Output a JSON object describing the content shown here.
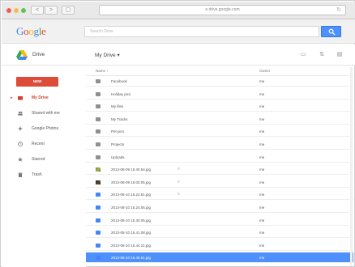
{
  "browser": {
    "url": "a drive.google.com",
    "back": "<",
    "forward": ">",
    "reload": "↻"
  },
  "header": {
    "logo": [
      "G",
      "o",
      "o",
      "g",
      "l",
      "e"
    ],
    "search_placeholder": "Search Drive"
  },
  "toolbar": {
    "drive_label": "Drive",
    "location": "My Drive ▾"
  },
  "sidebar": {
    "new_label": "NEW",
    "items": [
      {
        "label": "My Drive",
        "icon": "my-drive-icon",
        "active": true
      },
      {
        "label": "Shared with me",
        "icon": "people-icon",
        "active": false
      },
      {
        "label": "Google Photos",
        "icon": "photos-icon",
        "active": false
      },
      {
        "label": "Recent",
        "icon": "clock-icon",
        "active": false
      },
      {
        "label": "Starred",
        "icon": "star-icon",
        "active": false
      },
      {
        "label": "Trash",
        "icon": "trash-icon",
        "active": false
      }
    ]
  },
  "list": {
    "columns": {
      "name": "Name ↑",
      "owner": "Owner"
    },
    "rows": [
      {
        "name": "Facebook",
        "type": "folder",
        "owner": "me"
      },
      {
        "name": "Holiday pics",
        "type": "folder",
        "owner": "me"
      },
      {
        "name": "My files",
        "type": "folder",
        "owner": "me"
      },
      {
        "name": "My Tracks",
        "type": "folder",
        "owner": "me"
      },
      {
        "name": "Pet pics",
        "type": "folder",
        "owner": "me"
      },
      {
        "name": "Projects",
        "type": "folder",
        "owner": "me"
      },
      {
        "name": "Uploads",
        "type": "folder",
        "owner": "me"
      },
      {
        "name": "2013-08-09 15.40.54.jpg",
        "type": "photo-a",
        "owner": "me",
        "shared": "≡"
      },
      {
        "name": "2013-08-09 19.00.05.jpg",
        "type": "photo-b",
        "owner": "me",
        "shared": "≡"
      },
      {
        "name": "2013-08-10 15.22.51.jpg",
        "type": "doc",
        "owner": "me",
        "shared": "≡"
      },
      {
        "name": "2013-08-10 15.24.05.jpg",
        "type": "doc",
        "owner": "me"
      },
      {
        "name": "2013-08-10 15.30.05.jpg",
        "type": "doc",
        "owner": "me"
      },
      {
        "name": "2013-08-10 15.41.08.jpg",
        "type": "doc",
        "owner": "me"
      },
      {
        "name": "2013-08-10 15.44.21.jpg",
        "type": "doc",
        "owner": "me"
      },
      {
        "name": "2013-08-10 15.48.51.jpg",
        "type": "doc",
        "owner": "me",
        "selected": true
      }
    ]
  },
  "colors": {
    "accent": "#4d90fe",
    "new_button": "#dd4b39",
    "active_nav": "#d23f31"
  }
}
